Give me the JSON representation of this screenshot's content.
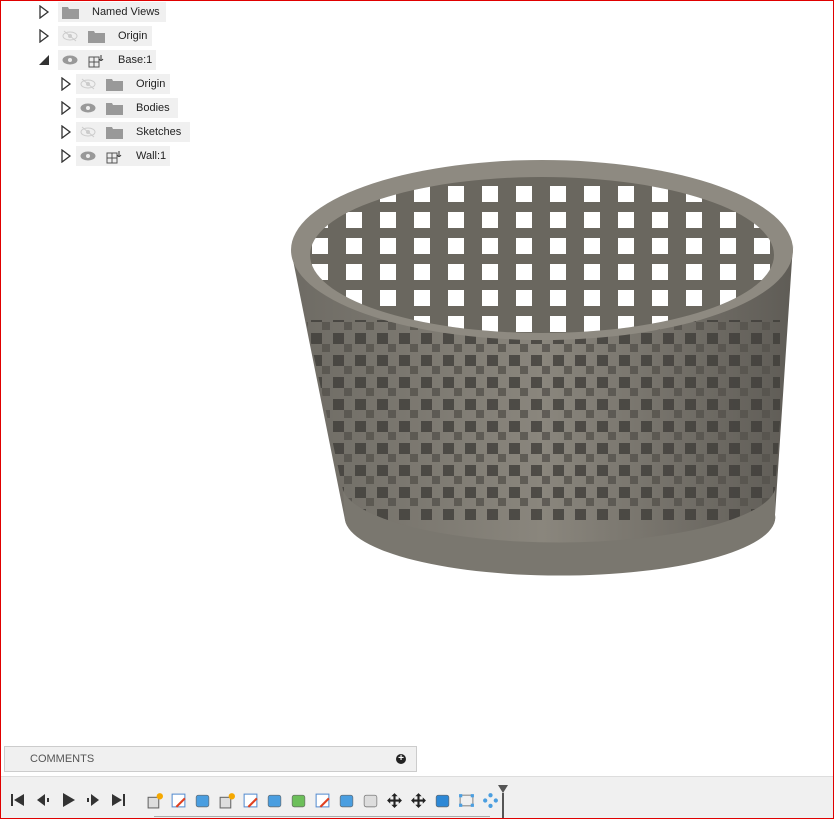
{
  "browser_tree": {
    "items": [
      {
        "label": "Named Views",
        "expanded": false,
        "visible": null,
        "icon": "folder-icon",
        "level": 0
      },
      {
        "label": "Origin",
        "expanded": false,
        "visible": false,
        "icon": "folder-icon",
        "level": 0
      },
      {
        "label": "Base:1",
        "expanded": true,
        "visible": true,
        "icon": "component-anchor-icon",
        "level": 0
      },
      {
        "label": "Origin",
        "expanded": false,
        "visible": false,
        "icon": "folder-icon",
        "level": 1
      },
      {
        "label": "Bodies",
        "expanded": false,
        "visible": true,
        "icon": "folder-icon",
        "level": 1
      },
      {
        "label": "Sketches",
        "expanded": false,
        "visible": false,
        "icon": "folder-icon",
        "level": 1
      },
      {
        "label": "Wall:1",
        "expanded": false,
        "visible": true,
        "icon": "component-anchor-icon",
        "level": 1
      }
    ]
  },
  "comments": {
    "label": "COMMENTS"
  },
  "timeline": {
    "playback": [
      "go-to-start",
      "step-back",
      "play",
      "step-forward",
      "go-to-end"
    ],
    "features": [
      "new-component",
      "sketch",
      "extrude",
      "new-component",
      "sketch",
      "revolve",
      "sweep",
      "sketch",
      "pipe",
      "joint",
      "move",
      "move",
      "combine",
      "pattern-sketch",
      "circular-pattern"
    ]
  },
  "colors": {
    "model": "#7d7a72",
    "border": "#e00000",
    "panel": "#f0f0f0"
  }
}
